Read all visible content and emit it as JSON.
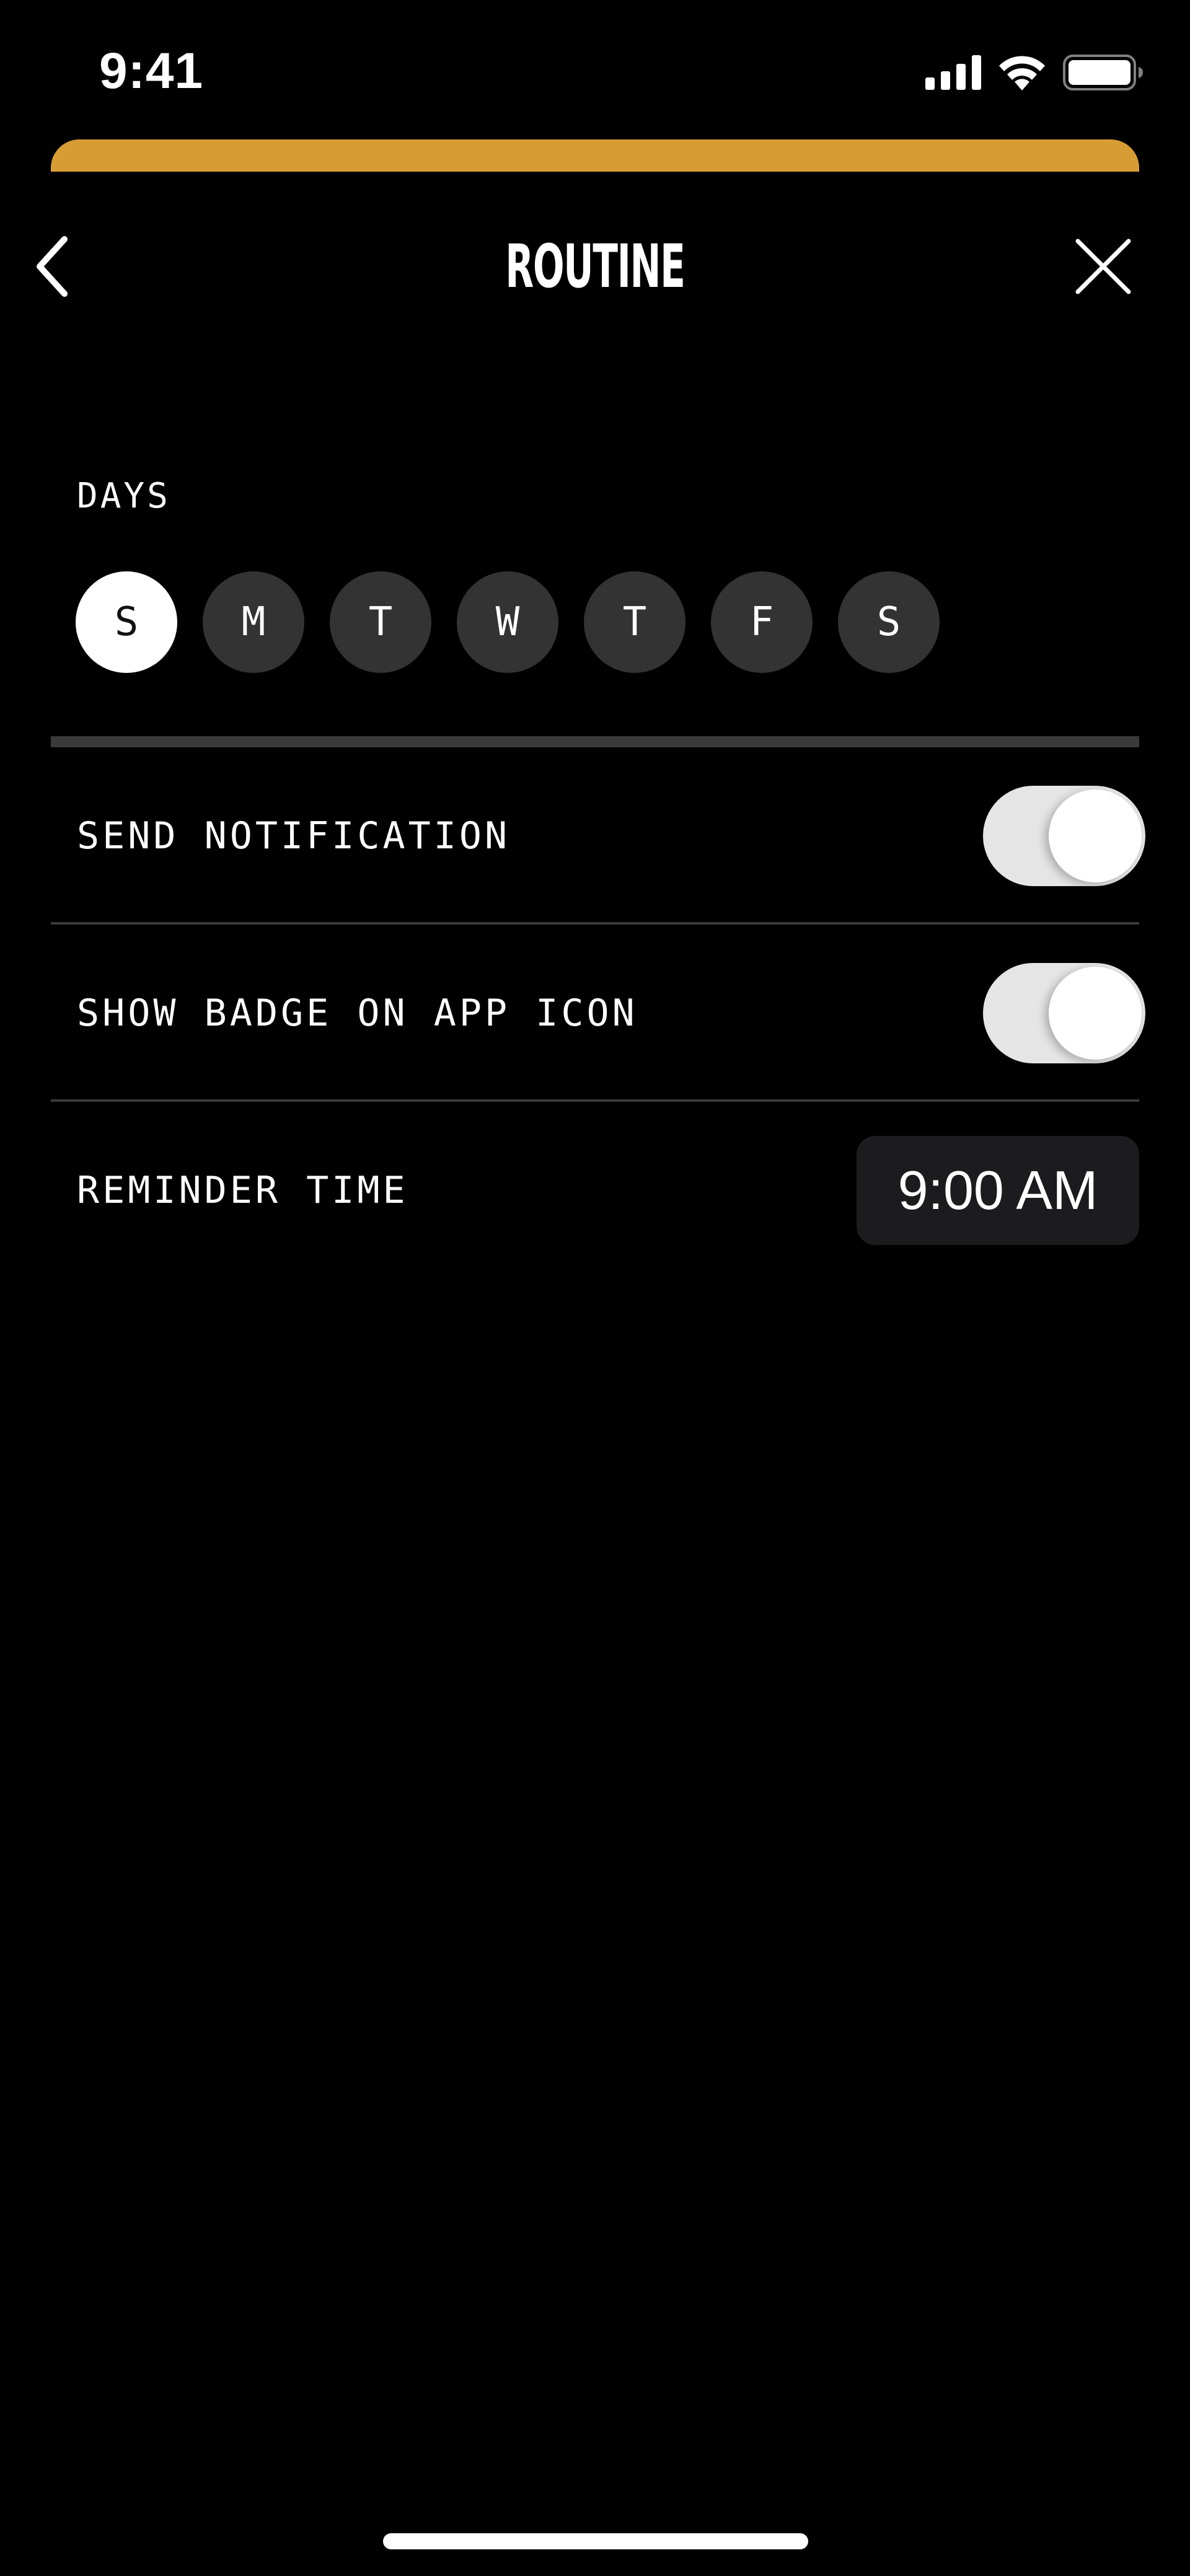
{
  "status_bar": {
    "time": "9:41",
    "icons": [
      "signal-icon",
      "wifi-icon",
      "battery-icon"
    ]
  },
  "colors": {
    "background": "#000000",
    "accent": "#d89c34",
    "day_inactive": "#333333",
    "day_selected": "#ffffff",
    "divider": "#3a3a3a",
    "toggle_on_track": "#e5e5e5",
    "time_picker_bg": "#1c1c1e"
  },
  "header": {
    "title": "ROUTINE",
    "back_icon": "chevron-left-icon",
    "close_icon": "close-icon"
  },
  "days": {
    "label": "DAYS",
    "items": [
      {
        "letter": "S",
        "selected": true
      },
      {
        "letter": "M",
        "selected": false
      },
      {
        "letter": "T",
        "selected": false
      },
      {
        "letter": "W",
        "selected": false
      },
      {
        "letter": "T",
        "selected": false
      },
      {
        "letter": "F",
        "selected": false
      },
      {
        "letter": "S",
        "selected": false
      }
    ]
  },
  "settings": {
    "send_notification": {
      "label": "SEND NOTIFICATION",
      "enabled": true
    },
    "show_badge": {
      "label": "SHOW BADGE ON APP ICON",
      "enabled": true
    },
    "reminder_time": {
      "label": "REMINDER TIME",
      "value": "9:00 AM"
    }
  }
}
